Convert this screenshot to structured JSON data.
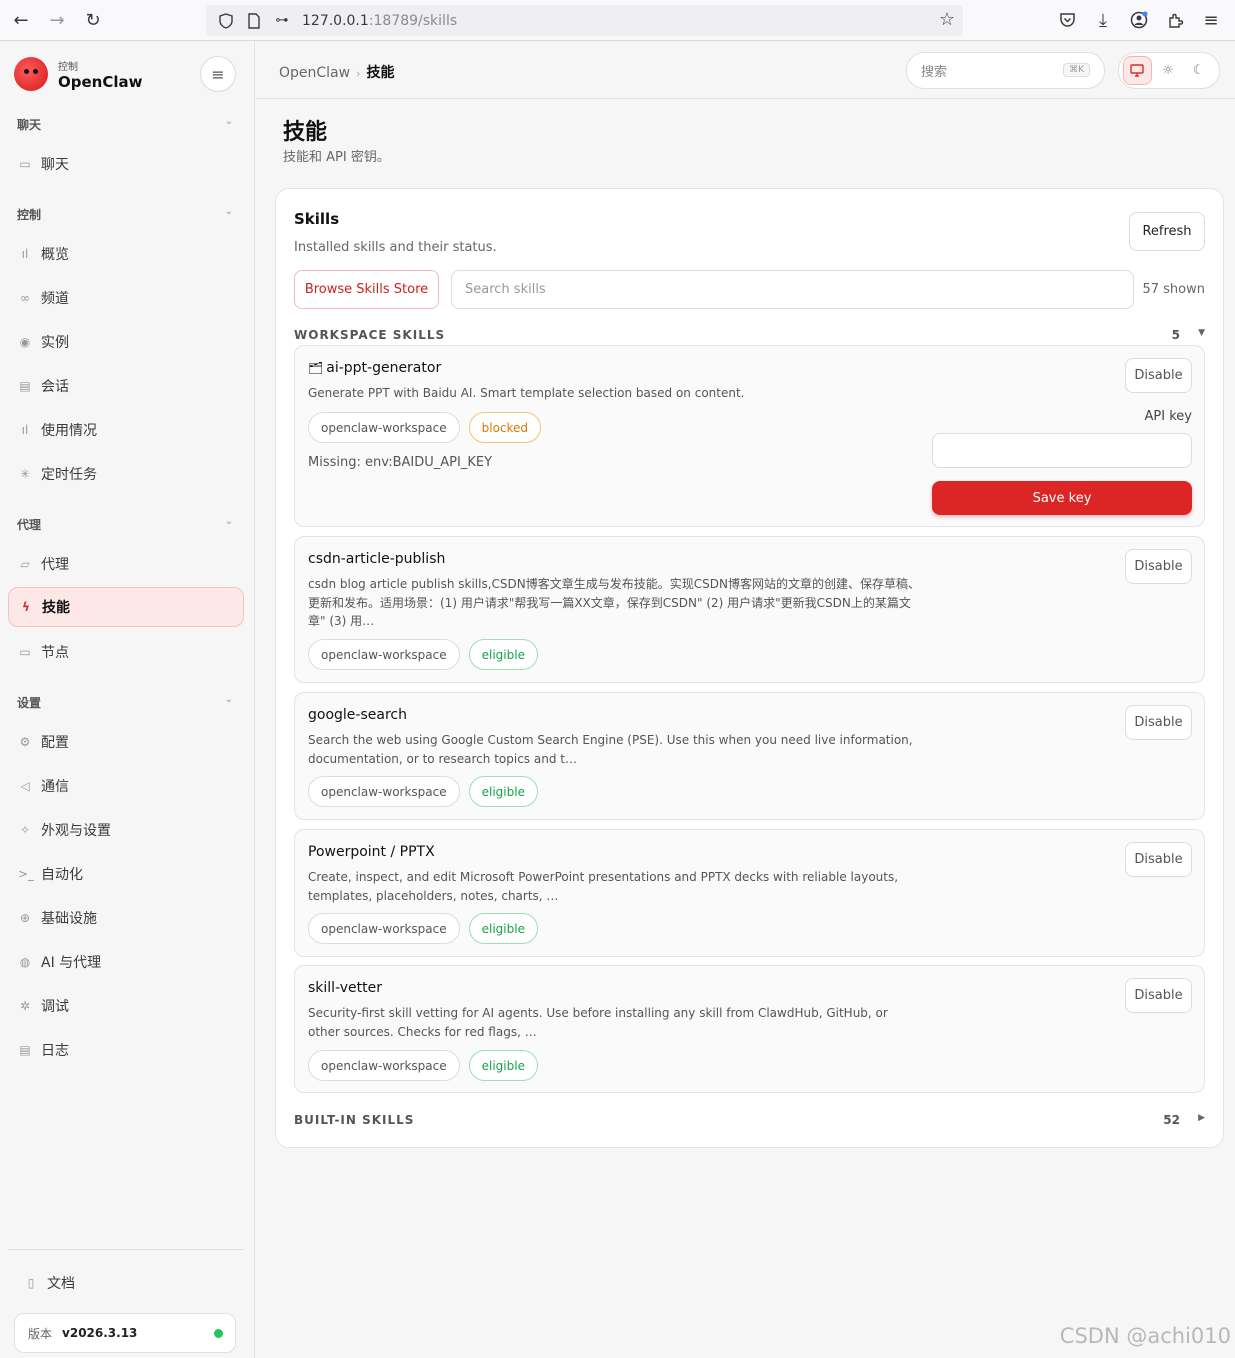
{
  "browser": {
    "url_host": "127.0.0.1",
    "url_rest": ":18789/skills"
  },
  "brand": {
    "small": "控制",
    "name": "OpenClaw"
  },
  "sidebar": {
    "sections": [
      {
        "label": "聊天",
        "items": [
          {
            "label": "聊天",
            "icon": "chat-icon"
          }
        ]
      },
      {
        "label": "控制",
        "items": [
          {
            "label": "概览",
            "icon": "bar-chart-icon"
          },
          {
            "label": "频道",
            "icon": "link-icon"
          },
          {
            "label": "实例",
            "icon": "radio-icon"
          },
          {
            "label": "会话",
            "icon": "document-icon"
          },
          {
            "label": "使用情况",
            "icon": "bar-chart-icon"
          },
          {
            "label": "定时任务",
            "icon": "loader-icon"
          }
        ]
      },
      {
        "label": "代理",
        "items": [
          {
            "label": "代理",
            "icon": "folder-icon"
          },
          {
            "label": "技能",
            "icon": "bolt-icon",
            "active": true
          },
          {
            "label": "节点",
            "icon": "monitor-icon"
          }
        ]
      },
      {
        "label": "设置",
        "items": [
          {
            "label": "配置",
            "icon": "gear-icon"
          },
          {
            "label": "通信",
            "icon": "send-icon"
          },
          {
            "label": "外观与设置",
            "icon": "sparkle-icon"
          },
          {
            "label": "自动化",
            "icon": "terminal-icon"
          },
          {
            "label": "基础设施",
            "icon": "globe-icon"
          },
          {
            "label": "AI 与代理",
            "icon": "brain-icon"
          },
          {
            "label": "调试",
            "icon": "bug-icon"
          },
          {
            "label": "日志",
            "icon": "log-icon"
          }
        ]
      }
    ],
    "docs": "文档",
    "version_label": "版本",
    "version_value": "v2026.3.13"
  },
  "header": {
    "crumb_root": "OpenClaw",
    "crumb_current": "技能",
    "search_placeholder": "搜索",
    "search_kbd": "⌘K"
  },
  "page": {
    "title": "技能",
    "subtitle": "技能和 API 密钥。"
  },
  "skills_card": {
    "title": "Skills",
    "subtitle": "Installed skills and their status.",
    "refresh": "Refresh",
    "browse_store": "Browse Skills Store",
    "search_placeholder": "Search skills",
    "shown": "57 shown",
    "workspace_label": "WORKSPACE SKILLS",
    "workspace_count": "5",
    "builtin_label": "BUILT-IN SKILLS",
    "builtin_count": "52",
    "disable_label": "Disable",
    "api_key_label": "API key",
    "save_key": "Save key",
    "skills": [
      {
        "emoji": "🗂",
        "name": "ai-ppt-generator",
        "desc": "Generate PPT with Baidu AI. Smart template selection based on content.",
        "source": "openclaw-workspace",
        "status": "blocked",
        "missing": "Missing: env:BAIDU_API_KEY"
      },
      {
        "name": "csdn-article-publish",
        "desc": "csdn blog article publish skills,CSDN博客文章生成与发布技能。实现CSDN博客网站的文章的创建、保存草稿、更新和发布。适用场景：(1) 用户请求\"帮我写一篇XX文章，保存到CSDN\" (2) 用户请求\"更新我CSDN上的某篇文章\" (3) 用…",
        "source": "openclaw-workspace",
        "status": "eligible"
      },
      {
        "name": "google-search",
        "desc": "Search the web using Google Custom Search Engine (PSE). Use this when you need live information, documentation, or to research topics and t…",
        "source": "openclaw-workspace",
        "status": "eligible"
      },
      {
        "name": "Powerpoint / PPTX",
        "desc": "Create, inspect, and edit Microsoft PowerPoint presentations and PPTX decks with reliable layouts, templates, placeholders, notes, charts, …",
        "source": "openclaw-workspace",
        "status": "eligible"
      },
      {
        "name": "skill-vetter",
        "desc": "Security-first skill vetting for AI agents. Use before installing any skill from ClawdHub, GitHub, or other sources. Checks for red flags, …",
        "source": "openclaw-workspace",
        "status": "eligible"
      }
    ]
  },
  "watermark": "CSDN @achi010"
}
